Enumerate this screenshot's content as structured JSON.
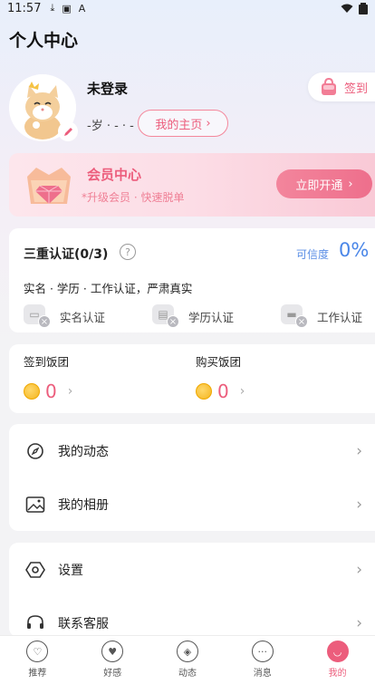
{
  "status_bar": {
    "time": "11:57",
    "icons": [
      "download-icon",
      "screenshot-icon",
      "font-icon"
    ],
    "right_icons": [
      "wifi-icon",
      "battery-icon"
    ]
  },
  "page_title": "个人中心",
  "profile": {
    "username": "未登录",
    "age_info": "-岁 · - · -",
    "homepage_button": "我的主页",
    "checkin_button": "签到"
  },
  "vip": {
    "title": "会员中心",
    "subtitle": "*升级会员 · 快速脱单",
    "button": "立即开通"
  },
  "verification": {
    "title": "三重认证(0/3)",
    "credit_label": "可信度",
    "credit_value": "0%",
    "description": "实名 · 学历 · 工作认证，严肃真实",
    "items": [
      {
        "label": "实名认证",
        "icon": "id-card-icon"
      },
      {
        "label": "学历认证",
        "icon": "diploma-icon"
      },
      {
        "label": "工作认证",
        "icon": "briefcase-icon"
      }
    ]
  },
  "rice_balls": {
    "checkin_label": "签到饭团",
    "checkin_value": "0",
    "purchase_label": "购买饭团",
    "purchase_value": "0"
  },
  "menu_group_1": [
    {
      "label": "我的动态",
      "icon": "compass-icon"
    },
    {
      "label": "我的相册",
      "icon": "photo-album-icon"
    }
  ],
  "menu_group_2": [
    {
      "label": "设置",
      "icon": "settings-icon"
    },
    {
      "label": "联系客服",
      "icon": "headset-icon"
    }
  ],
  "tabbar": [
    {
      "label": "推荐",
      "icon": "recommend-icon"
    },
    {
      "label": "好感",
      "icon": "heart-icon"
    },
    {
      "label": "动态",
      "icon": "compass-icon"
    },
    {
      "label": "消息",
      "icon": "message-icon"
    },
    {
      "label": "我的",
      "icon": "profile-icon",
      "active": true
    }
  ],
  "colors": {
    "accent": "#ec5d7c",
    "credit_blue": "#4a86e8"
  }
}
